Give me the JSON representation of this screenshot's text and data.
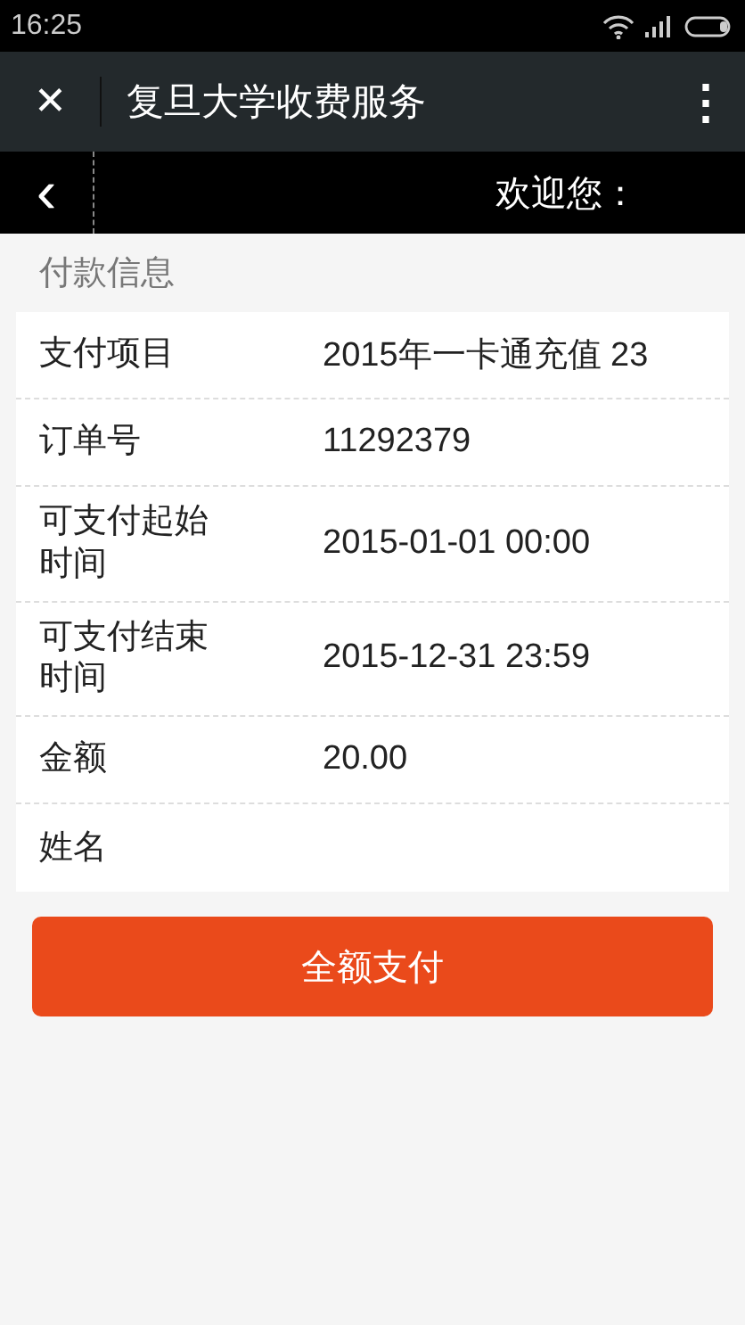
{
  "status_bar": {
    "time": "16:25"
  },
  "title_bar": {
    "close": "✕",
    "title": "复旦大学收费服务",
    "menu": "⋮"
  },
  "nav_bar": {
    "back": "‹",
    "welcome": "欢迎您："
  },
  "section": {
    "title": "付款信息"
  },
  "rows": [
    {
      "label": "支付项目",
      "value": "2015年一卡通充值 23"
    },
    {
      "label": "订单号",
      "value": "11292379"
    },
    {
      "label": "可支付起始时间",
      "value": "2015-01-01 00:00"
    },
    {
      "label": "可支付结束时间",
      "value": "2015-12-31 23:59"
    },
    {
      "label": "金额",
      "value": "20.00"
    },
    {
      "label": "姓名"
    }
  ],
  "pay_button": "全额支付"
}
